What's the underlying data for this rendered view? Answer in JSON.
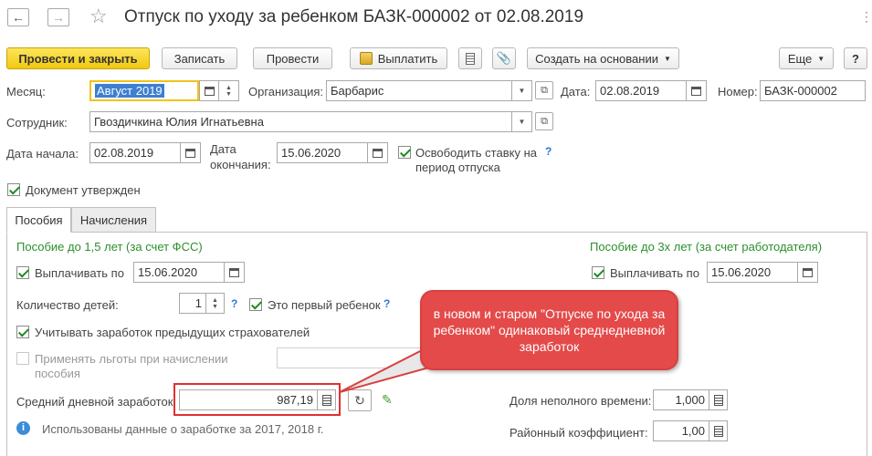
{
  "window": {
    "title": "Отпуск по уходу за ребенком БАЗК-000002 от 02.08.2019"
  },
  "toolbar": {
    "post_close": "Провести и закрыть",
    "save": "Записать",
    "post": "Провести",
    "pay": "Выплатить",
    "create_based": "Создать на основании",
    "more": "Еще",
    "help": "?"
  },
  "header": {
    "month_label": "Месяц:",
    "month_value": "Август 2019",
    "org_label": "Организация:",
    "org_value": "Барбарис",
    "date_label": "Дата:",
    "date_value": "02.08.2019",
    "number_label": "Номер:",
    "number_value": "БАЗК-000002",
    "employee_label": "Сотрудник:",
    "employee_value": "Гвоздичкина Юлия Игнатьевна",
    "start_label": "Дата начала:",
    "start_value": "02.08.2019",
    "end_label_1": "Дата",
    "end_label_2": "окончания:",
    "end_value": "15.06.2020",
    "free_rate_1": "Освободить ставку на",
    "free_rate_2": "период отпуска",
    "approved": "Документ утвержден"
  },
  "tabs": {
    "benefits": "Пособия",
    "accruals": "Начисления"
  },
  "benefits": {
    "fss_title": "Пособие до 1,5 лет (за счет ФСС)",
    "employer_title": "Пособие до 3х лет (за счет работодателя)",
    "pay_until_label": "Выплачивать по",
    "pay_until_value": "15.06.2020",
    "pay_until_3_label": "Выплачивать по",
    "pay_until_3_value": "15.06.2020",
    "children_label": "Количество детей:",
    "children_value": "1",
    "first_child": "Это первый ребенок",
    "prev_insurers": "Учитывать заработок предыдущих страхователей",
    "benefits_1": "Применять льготы при начислении",
    "benefits_2": "пособия",
    "avg_label": "Средний дневной заработок:",
    "avg_value": "987,19",
    "part_time_label": "Доля неполного времени:",
    "part_time_value": "1,000",
    "regional_label": "Районный коэффициент:",
    "regional_value": "1,00",
    "info": "Использованы данные о заработке за  2017,  2018 г."
  },
  "callout": {
    "text": "в новом и старом \"Отпуске по ухода за ребенком\" одинаковый среднедневной заработок"
  }
}
